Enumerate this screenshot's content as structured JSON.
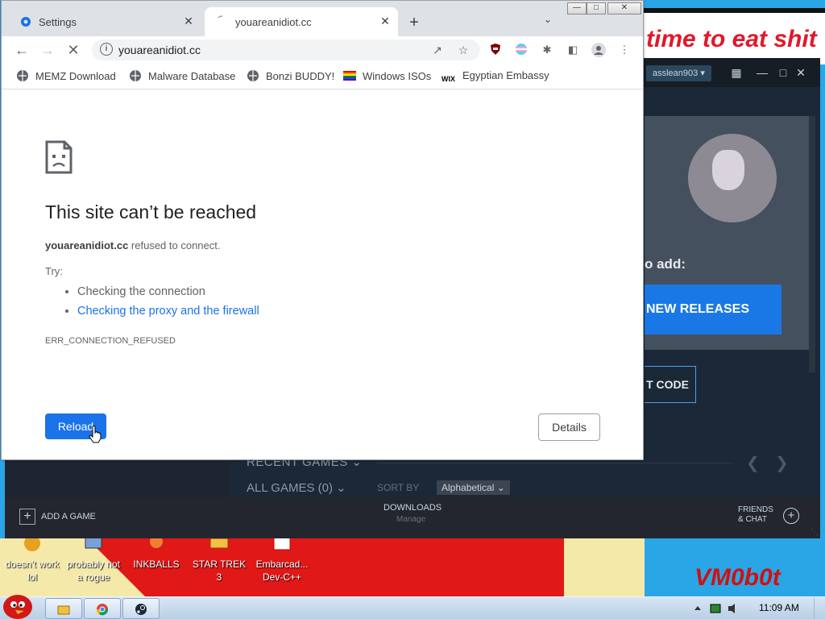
{
  "desktop": {
    "banner_text": "time to eat shit",
    "watermark": "VM0b0t",
    "icons": [
      {
        "label": "doesn't work lol",
        "icon": "angry-bird-icon"
      },
      {
        "label": "probably not a rogue",
        "icon": "computer-icon"
      },
      {
        "label": "INKBALLS",
        "icon": "inkballs-icon"
      },
      {
        "label": "STAR TREK 3",
        "icon": "star-trek-icon"
      },
      {
        "label": "Embarcad... Dev-C++",
        "icon": "devcpp-icon"
      }
    ]
  },
  "steam": {
    "username": "asslean903",
    "to_add_text": "o add:",
    "new_releases": "NEW RELEASES",
    "code_button": "T CODE",
    "recent_games": "RECENT GAMES",
    "all_games": "ALL GAMES (0)",
    "sort_by": "SORT BY",
    "sort_value": "Alphabetical",
    "add_game": "ADD A GAME",
    "downloads": "DOWNLOADS",
    "downloads_manage": "Manage",
    "friends_chat_line1": "FRIENDS",
    "friends_chat_line2": "& CHAT"
  },
  "chrome": {
    "tabs": [
      {
        "title": "Settings",
        "icon": "settings-gear-icon",
        "active": false
      },
      {
        "title": "youareanidiot.cc",
        "icon": "loading-icon",
        "active": true
      }
    ],
    "url": "youareanidiot.cc",
    "bookmarks": [
      {
        "label": "MEMZ Download",
        "icon": "globe-icon"
      },
      {
        "label": "Malware Database",
        "icon": "globe-icon"
      },
      {
        "label": "Bonzi BUDDY!",
        "icon": "globe-icon"
      },
      {
        "label": "Windows ISOs",
        "icon": "rainbow-flag-icon"
      },
      {
        "label": "Egyptian Embassy",
        "icon": "wix-icon"
      }
    ],
    "wix_badge": "WIX",
    "error": {
      "title": "This site can’t be reached",
      "host": "youareanidiot.cc",
      "message": " refused to connect.",
      "try_label": "Try:",
      "suggestions": [
        "Checking the connection",
        "Checking the proxy and the firewall"
      ],
      "code": "ERR_CONNECTION_REFUSED",
      "reload": "Reload",
      "details": "Details"
    }
  },
  "taskbar": {
    "clock": "11:09 AM",
    "apps": [
      "explorer-icon",
      "chrome-icon",
      "steam-icon"
    ]
  },
  "colors": {
    "accent": "#1a73e8",
    "steam_blue": "#1a78e6",
    "desktop_blue": "#2aa6e6",
    "desktop_red": "#e01818"
  }
}
